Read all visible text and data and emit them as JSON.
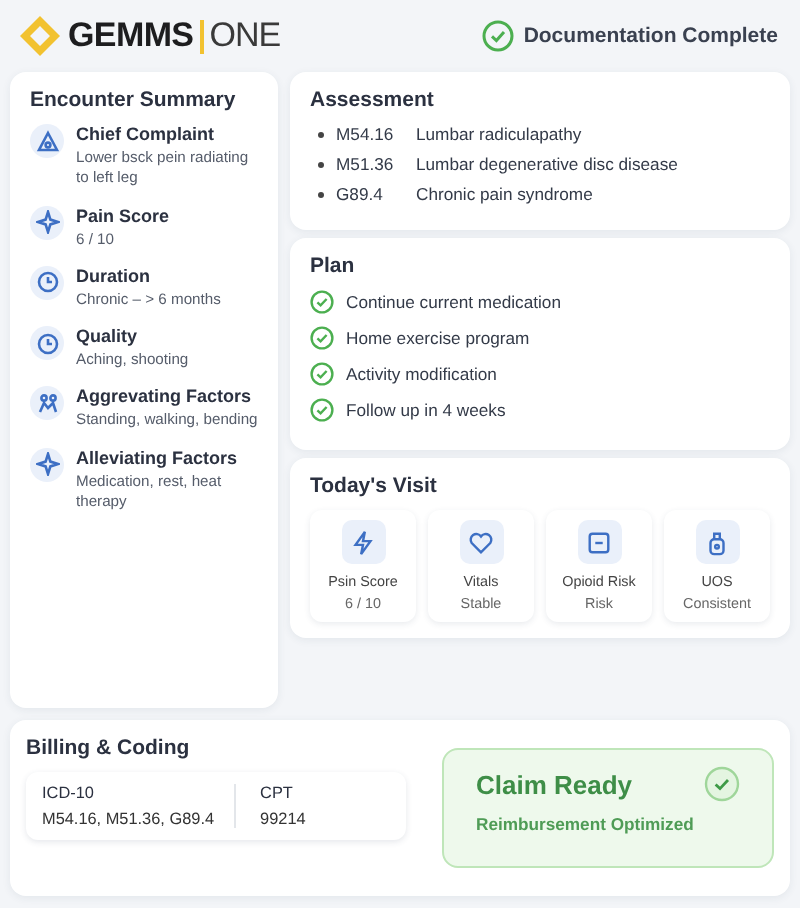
{
  "header": {
    "logo_main": "GEMMS",
    "logo_sub": "ONE",
    "status": "Documentation Complete"
  },
  "encounter_summary": {
    "title": "Encounter Summary",
    "items": [
      {
        "label": "Chief Complaint",
        "value": "Lower bsck pein radiating to left leg"
      },
      {
        "label": "Pain Score",
        "value": "6 / 10"
      },
      {
        "label": "Duration",
        "value": "Chronic – > 6 months"
      },
      {
        "label": "Quality",
        "value": "Aching, shooting"
      },
      {
        "label": "Aggrevating Factors",
        "value": "Standing, walking, bending"
      },
      {
        "label": "Alleviating Factors",
        "value": "Medication, rest, heat therapy"
      }
    ]
  },
  "assessment": {
    "title": "Assessment",
    "items": [
      {
        "code": "M54.16",
        "description": "Lumbar radiculapathy"
      },
      {
        "code": "M51.36",
        "description": "Lumbar degenerative disc disease"
      },
      {
        "code": "G89.4",
        "description": "Chronic pain syndrome"
      }
    ]
  },
  "plan": {
    "title": "Plan",
    "items": [
      {
        "text": "Continue current medication",
        "checked": true
      },
      {
        "text": "Home exercise program",
        "checked": true
      },
      {
        "text": "Activity modification",
        "checked": true
      },
      {
        "text": "Follow up in 4 weeks",
        "checked": true
      }
    ]
  },
  "todays_visit": {
    "title": "Today's Visit",
    "tiles": [
      {
        "label": "Psin Score",
        "value": "6 / 10"
      },
      {
        "label": "Vitals",
        "value": "Stable"
      },
      {
        "label": "Opioid Risk",
        "value": "Risk"
      },
      {
        "label": "UOS",
        "value": "Consistent"
      }
    ]
  },
  "billing": {
    "title": "Billing & Coding",
    "columns": [
      {
        "label": "ICD-10",
        "value": "M54.16, M51.36, G89.4"
      },
      {
        "label": "CPT",
        "value": "99214"
      }
    ],
    "claim": {
      "title": "Claim Ready",
      "subtitle": "Reimbursement Optimized"
    }
  }
}
